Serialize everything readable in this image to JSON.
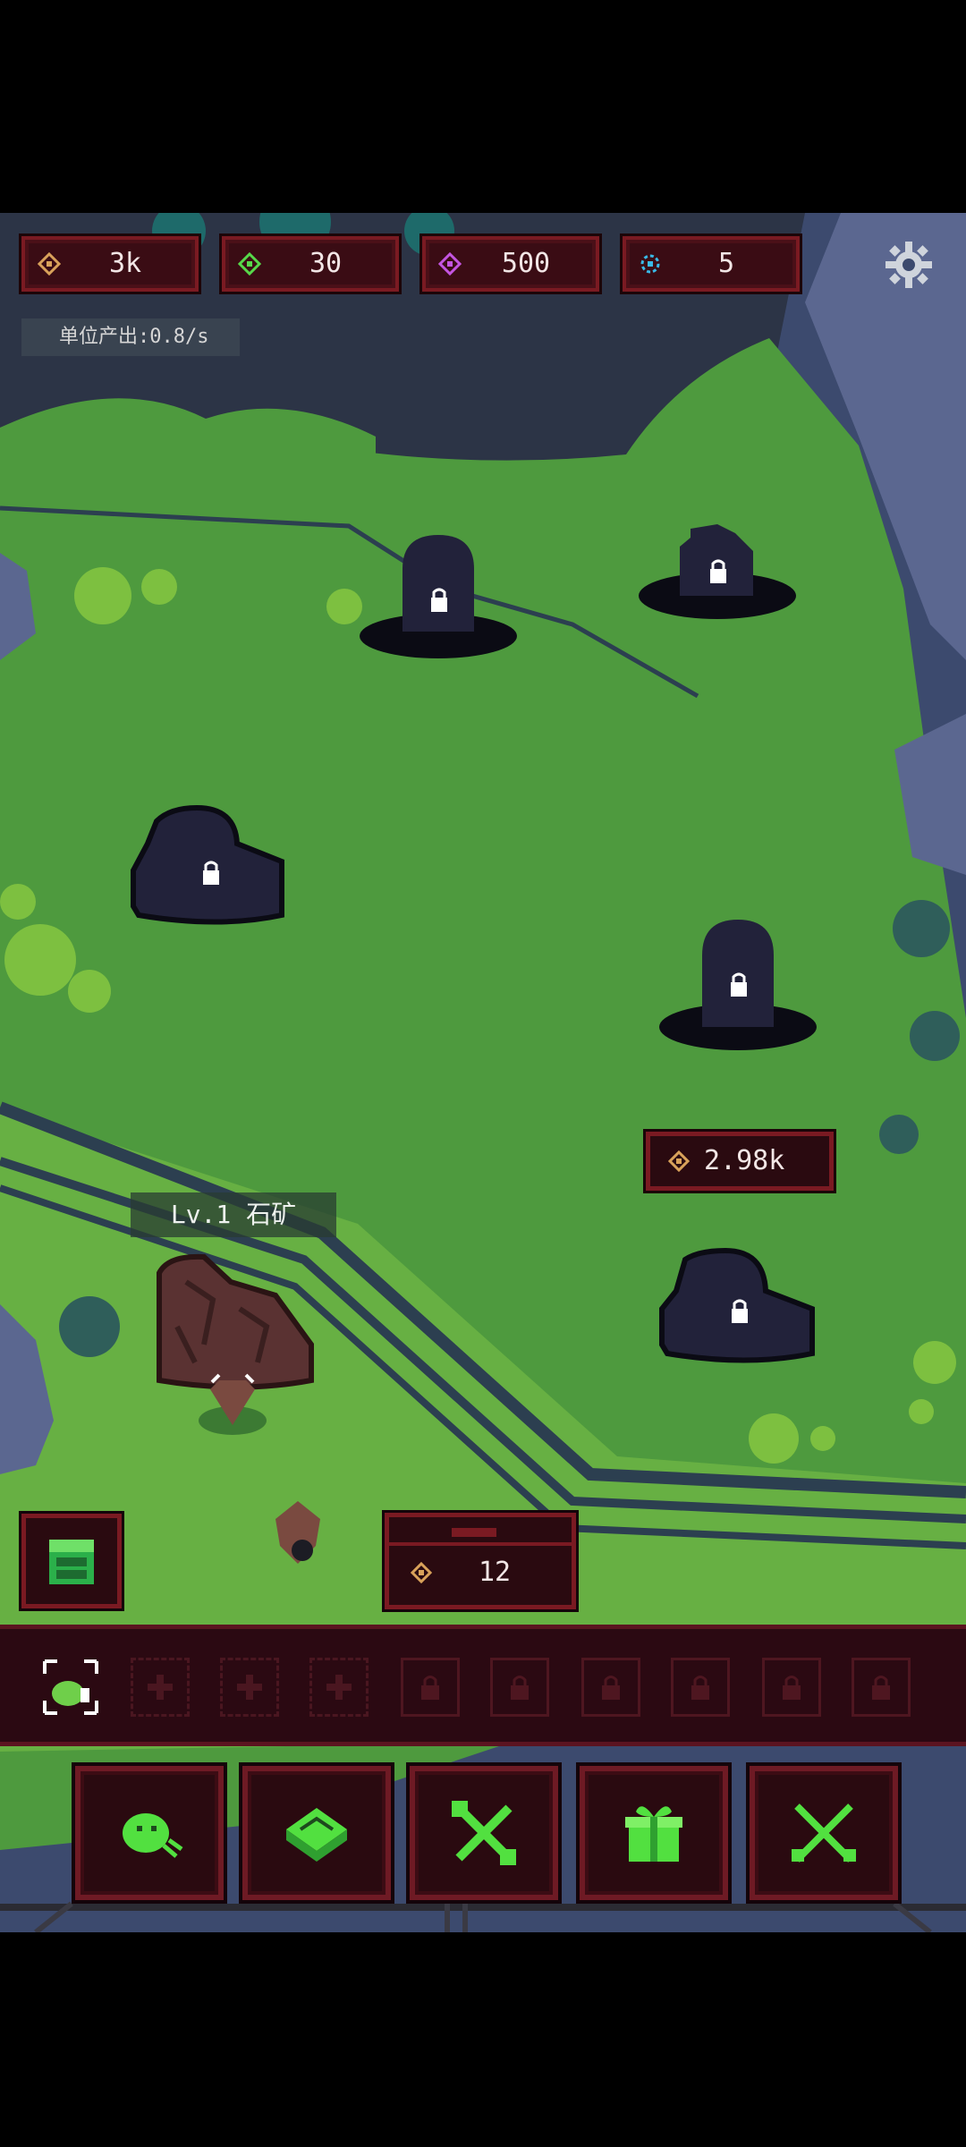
{
  "resources": [
    {
      "icon": "gold-coin-icon",
      "value": "3k",
      "color": "#d9a25a"
    },
    {
      "icon": "green-gem-icon",
      "value": "30",
      "color": "#57d84a"
    },
    {
      "icon": "purple-gem-icon",
      "value": "500",
      "color": "#c455e0"
    },
    {
      "icon": "blue-gear-gem-icon",
      "value": "5",
      "color": "#39b9e6"
    }
  ],
  "settings_icon": "gear-icon",
  "production_rate": "单位产出:0.8/s",
  "unlock_price": "2.98k",
  "mine_label": "Lv.1 石矿",
  "chest_value": "12",
  "locked_nodes": 6,
  "slots": {
    "active": 1,
    "add": 3,
    "locked": 6
  },
  "nav": [
    {
      "name": "nav-summon-button",
      "icon": "slime-icon"
    },
    {
      "name": "nav-book-button",
      "icon": "book-icon"
    },
    {
      "name": "nav-tools-button",
      "icon": "tools-icon"
    },
    {
      "name": "nav-gift-button",
      "icon": "gift-icon"
    },
    {
      "name": "nav-battle-button",
      "icon": "crossed-swords-icon"
    }
  ],
  "colors": {
    "frame": "#7a1a22",
    "panel": "#2a0a10",
    "grass": "#4f9a3c",
    "accent_green": "#52e040"
  }
}
